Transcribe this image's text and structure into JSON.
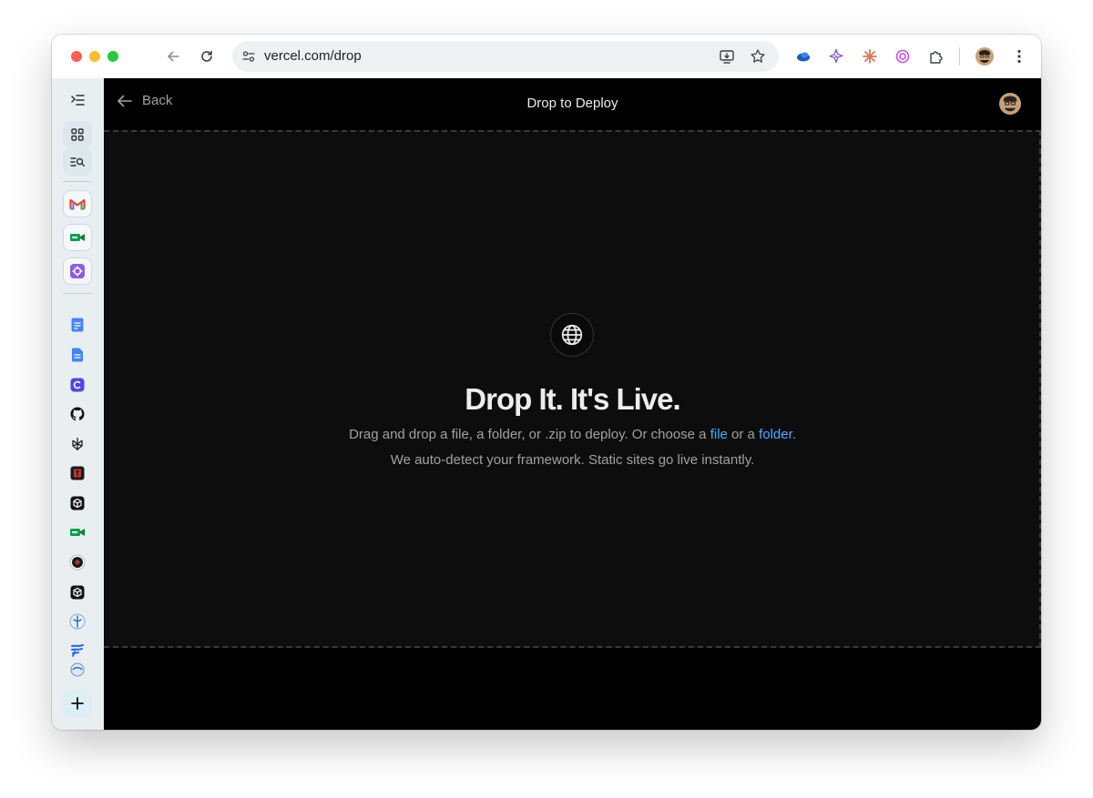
{
  "browser": {
    "url": "vercel.com/drop",
    "colors": {
      "close": "#ff5f57",
      "minimize": "#febc2e",
      "zoom": "#28c840"
    },
    "extensions": [
      "cloud-extension-icon",
      "sparkle-extension-icon",
      "claude-extension-icon",
      "openai-extension-icon",
      "puzzle-icon"
    ]
  },
  "sidebar": {
    "items": [
      "collapse-panel-icon",
      "apps-grid-icon",
      "search-list-icon",
      "gmail-icon",
      "meet-icon",
      "purple-app-icon",
      "docs-icon",
      "docs-icon",
      "clipboard-app-icon",
      "github-icon",
      "perplexity-icon",
      "red-app-icon",
      "cube-app-icon",
      "meet-icon",
      "dark-circle-app-icon",
      "cube-app-icon",
      "blue-circle-app-icon",
      "flag-app-icon",
      "partial-app-icon",
      "plus-icon"
    ]
  },
  "header": {
    "back_label": "Back",
    "title": "Drop to Deploy"
  },
  "dropzone": {
    "heading": "Drop It. It's Live.",
    "line1_prefix": "Drag and drop a file, a folder, or .zip to deploy. Or choose a ",
    "line1_file": "file",
    "line1_or": " or a ",
    "line1_folder": "folder",
    "line1_suffix": ".",
    "line2": "We auto-detect your framework. Static sites go live instantly.",
    "link_color": "#52a8ff"
  }
}
